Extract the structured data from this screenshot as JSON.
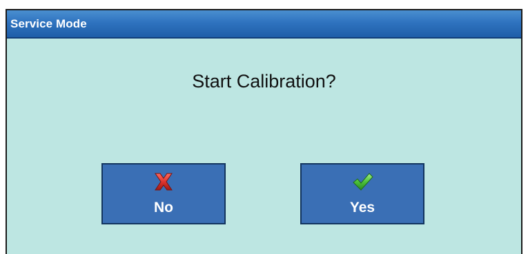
{
  "window": {
    "title": "Service Mode"
  },
  "dialog": {
    "prompt": "Start Calibration?"
  },
  "buttons": {
    "no": {
      "label": "No",
      "icon": "red-x-icon"
    },
    "yes": {
      "label": "Yes",
      "icon": "green-check-icon"
    }
  },
  "colors": {
    "title_bar": "#2f73bf",
    "dialog_background": "#bde6e2",
    "button_background": "#3a6fb5",
    "no_icon": "#d9312b",
    "yes_icon": "#4cc23a"
  }
}
